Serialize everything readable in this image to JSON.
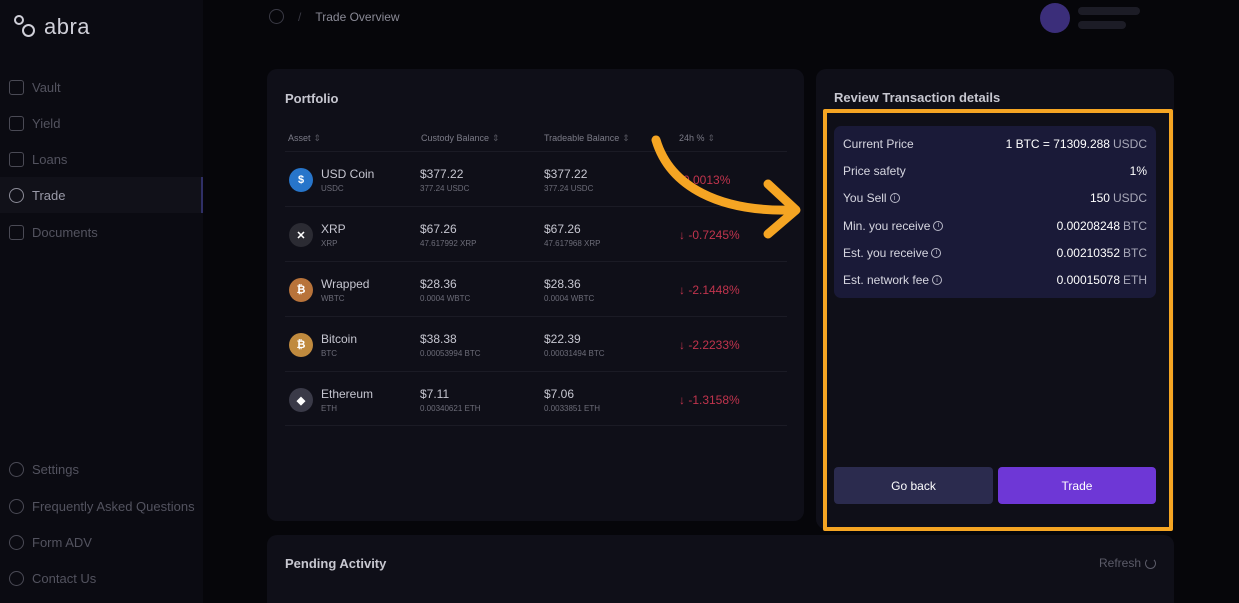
{
  "app": {
    "logo_text": "abra"
  },
  "sidebar": {
    "items": [
      {
        "label": "Vault",
        "icon": "vault-icon"
      },
      {
        "label": "Yield",
        "icon": "yield-icon"
      },
      {
        "label": "Loans",
        "icon": "loans-icon"
      },
      {
        "label": "Trade",
        "icon": "trade-icon",
        "active": true
      },
      {
        "label": "Documents",
        "icon": "documents-icon"
      }
    ],
    "bottom_items": [
      {
        "label": "Settings",
        "icon": "settings-icon"
      },
      {
        "label": "Frequently Asked Questions",
        "icon": "faq-icon"
      },
      {
        "label": "Form ADV",
        "icon": "form-icon"
      },
      {
        "label": "Contact Us",
        "icon": "contact-icon"
      }
    ]
  },
  "breadcrumb": {
    "current": "Trade Overview",
    "separator": "/"
  },
  "portfolio": {
    "title": "Portfolio",
    "columns": [
      "Asset",
      "Custody Balance",
      "Tradeable Balance",
      "24h %"
    ],
    "rows": [
      {
        "name": "USD Coin",
        "symbol": "USDC",
        "custody": "$377.22",
        "custody_sub": "377.24 USDC",
        "tradeable": "$377.22",
        "tradeable_sub": "377.24 USDC",
        "change": "-0.0013%",
        "color": "#2775ca",
        "glyph": "$"
      },
      {
        "name": "XRP",
        "symbol": "XRP",
        "custody": "$67.26",
        "custody_sub": "47.617992 XRP",
        "tradeable": "$67.26",
        "tradeable_sub": "47.617968 XRP",
        "change": "↓ -0.7245%",
        "color": "#2b2b33",
        "glyph": "✕"
      },
      {
        "name": "Wrapped",
        "symbol": "WBTC",
        "custody": "$28.36",
        "custody_sub": "0.0004 WBTC",
        "tradeable": "$28.36",
        "tradeable_sub": "0.0004 WBTC",
        "change": "↓ -2.1448%",
        "color": "#b8733a",
        "glyph": "₿"
      },
      {
        "name": "Bitcoin",
        "symbol": "BTC",
        "custody": "$38.38",
        "custody_sub": "0.00053994 BTC",
        "tradeable": "$22.39",
        "tradeable_sub": "0.00031494 BTC",
        "change": "↓ -2.2233%",
        "color": "#c08a3e",
        "glyph": "₿"
      },
      {
        "name": "Ethereum",
        "symbol": "ETH",
        "custody": "$7.11",
        "custody_sub": "0.00340621 ETH",
        "tradeable": "$7.06",
        "tradeable_sub": "0.0033851 ETH",
        "change": "↓ -1.3158%",
        "color": "#3a3a48",
        "glyph": "◆"
      }
    ]
  },
  "review": {
    "title": "Review Transaction details",
    "details": [
      {
        "label": "Current Price",
        "value": "1 BTC = 71309.288",
        "unit": "USDC",
        "info": false
      },
      {
        "label": "Price safety",
        "value": "1%",
        "unit": "",
        "info": false
      },
      {
        "label": "You Sell",
        "value": "150",
        "unit": "USDC",
        "info": true
      },
      {
        "label": "Min. you receive",
        "value": "0.00208248",
        "unit": "BTC",
        "info": true
      },
      {
        "label": "Est. you receive",
        "value": "0.00210352",
        "unit": "BTC",
        "info": true
      },
      {
        "label": "Est. network fee",
        "value": "0.00015078",
        "unit": "ETH",
        "info": true
      }
    ],
    "back_label": "Go back",
    "trade_label": "Trade"
  },
  "pending": {
    "title": "Pending Activity",
    "refresh_label": "Refresh"
  },
  "colors": {
    "accent": "#6e37d6",
    "highlight": "#f5a523",
    "negative": "#c0344d"
  }
}
